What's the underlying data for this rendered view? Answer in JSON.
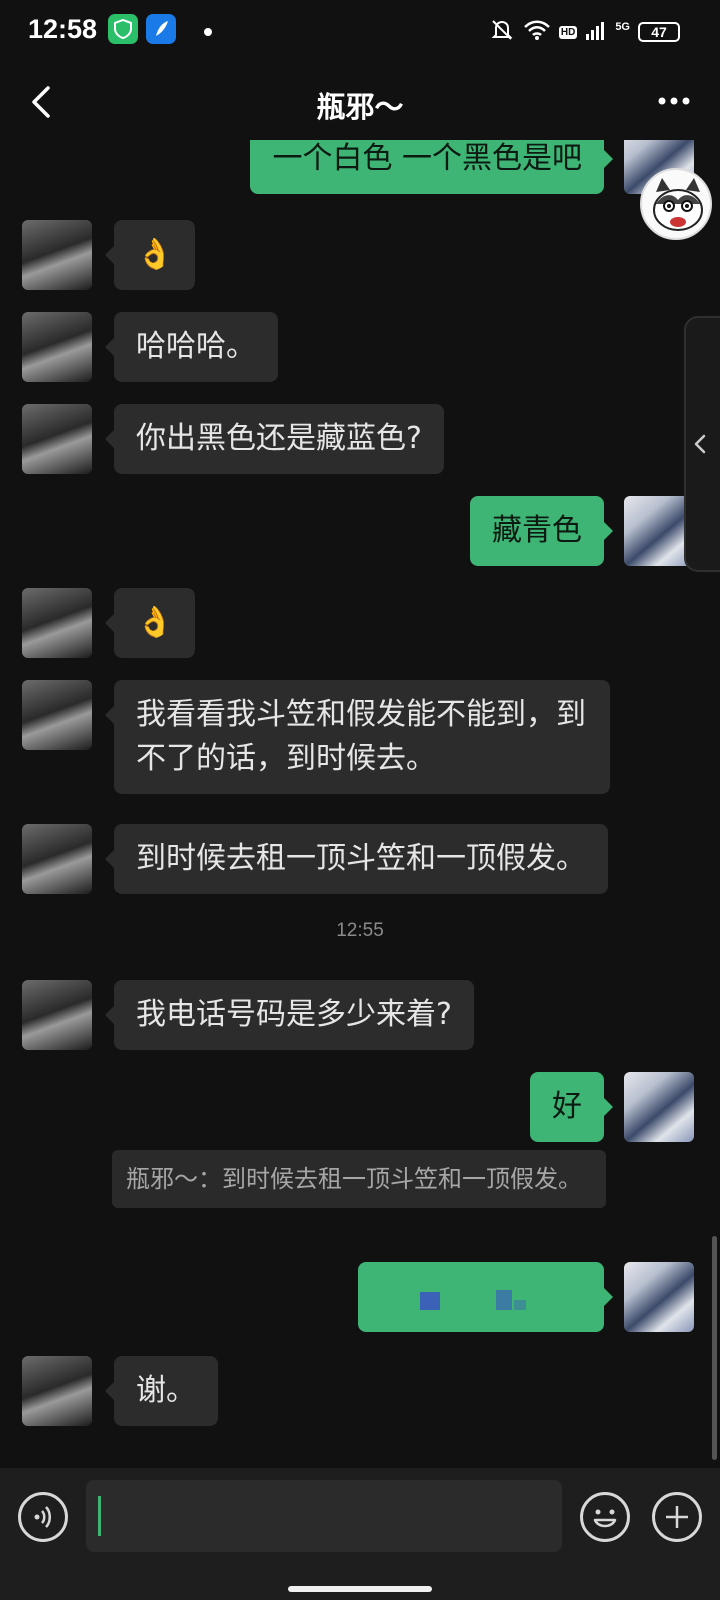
{
  "status_bar": {
    "time": "12:58",
    "network": "5G",
    "hd": "HD",
    "battery": "47"
  },
  "header": {
    "title": "瓶邪～"
  },
  "messages": [
    {
      "side": "me",
      "text": "一个白色 一个黑色是吧"
    },
    {
      "side": "other",
      "text": "👌"
    },
    {
      "side": "other",
      "text": "哈哈哈。"
    },
    {
      "side": "other",
      "text": "你出黑色还是藏蓝色?"
    },
    {
      "side": "me",
      "text": "藏青色"
    },
    {
      "side": "other",
      "text": "👌"
    },
    {
      "side": "other",
      "text": "我看看我斗笠和假发能不能到，到不了的话，到时候去。"
    },
    {
      "side": "other",
      "text": "到时候去租一顶斗笠和一顶假发。"
    },
    {
      "side": "other",
      "text": "我电话号码是多少来着?"
    },
    {
      "side": "me",
      "text": "好"
    },
    {
      "side": "me",
      "text": ""
    },
    {
      "side": "other",
      "text": "谢。"
    }
  ],
  "timestamp": "12:55",
  "quote": "瓶邪～：到时候去租一顶斗笠和一顶假发。",
  "input": {
    "value": "",
    "placeholder": ""
  },
  "colors": {
    "background": "#111111",
    "bubble_mine": "#3eb575",
    "bubble_other": "#2c2c2c"
  },
  "icons": [
    "back-icon",
    "more-icon",
    "voice-icon",
    "emoji-icon",
    "plus-icon"
  ]
}
